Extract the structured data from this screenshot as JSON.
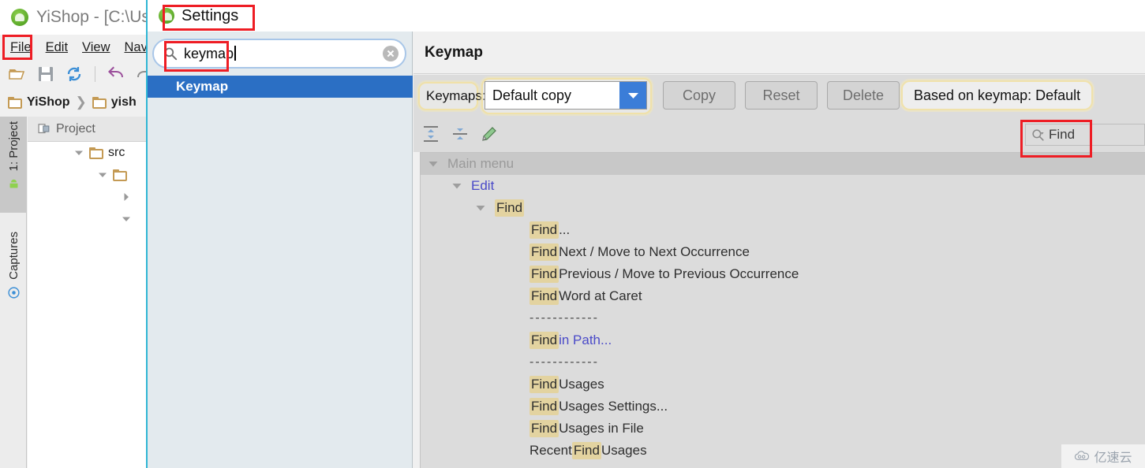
{
  "ide": {
    "title": "YiShop - [C:\\User",
    "app_icon": "android-studio-icon",
    "menus": [
      {
        "label": "File",
        "mnemonic": "F"
      },
      {
        "label": "Edit",
        "mnemonic": "E"
      },
      {
        "label": "View",
        "mnemonic": "V"
      },
      {
        "label": "Nav",
        "mnemonic": "N"
      }
    ],
    "toolbar_icons": [
      "open-folder-icon",
      "save-icon",
      "sync-icon",
      "undo-icon",
      "redo-icon"
    ],
    "breadcrumb": [
      {
        "label": "YiShop",
        "icon": "folder-icon"
      },
      {
        "label": "yish",
        "icon": "folder-icon"
      }
    ],
    "sidebar_tabs": [
      {
        "label": "1: Project",
        "icon": "android-icon",
        "active": true
      },
      {
        "label": "Captures",
        "icon": "captures-icon",
        "active": false
      }
    ],
    "project_tab": {
      "label": "Project",
      "icon": "project-view-icon"
    },
    "tree": [
      {
        "label": "src",
        "icon": "folder-icon",
        "expanded": true,
        "indent": 1
      },
      {
        "label": "",
        "icon": "folder-icon",
        "expanded": true,
        "indent": 2
      },
      {
        "label": "",
        "icon": "",
        "expanded": false,
        "indent": 3
      },
      {
        "label": "",
        "icon": "",
        "expanded": true,
        "indent": 3
      }
    ]
  },
  "dialog": {
    "title": "Settings",
    "icon": "android-studio-icon",
    "search": {
      "value": "keymap",
      "placeholder": "",
      "icon": "search-icon",
      "clear_icon": "clear-circle-icon"
    },
    "results": [
      {
        "label": "Keymap",
        "selected": true
      }
    ],
    "pane": {
      "title": "Keymap",
      "keymaps_label": "Keymaps:",
      "keymaps_value": "Default copy",
      "dropdown_icon": "chevron-down-icon",
      "buttons": [
        {
          "label": "Copy",
          "name": "copy-button"
        },
        {
          "label": "Reset",
          "name": "reset-button"
        },
        {
          "label": "Delete",
          "name": "delete-button"
        }
      ],
      "based_on": "Based on keymap: Default",
      "tool_icons": [
        "expand-all-icon",
        "collapse-all-icon",
        "edit-shortcut-icon"
      ],
      "find_label": "Find",
      "find_icon": "search-dropdown-icon"
    },
    "tree": [
      {
        "type": "node",
        "indent": 0,
        "arrow": "down",
        "label": "Main menu",
        "style": "header"
      },
      {
        "type": "node",
        "indent": 1,
        "arrow": "down",
        "label": "Edit",
        "style": "link"
      },
      {
        "type": "node",
        "indent": 2,
        "arrow": "down",
        "label": "Find",
        "style": "highlight-all"
      },
      {
        "type": "leaf",
        "indent": 3,
        "highlight": "Find",
        "rest": "..."
      },
      {
        "type": "leaf",
        "indent": 3,
        "highlight": "Find",
        "rest": " Next / Move to Next Occurrence"
      },
      {
        "type": "leaf",
        "indent": 3,
        "highlight": "Find",
        "rest": " Previous / Move to Previous Occurrence"
      },
      {
        "type": "leaf",
        "indent": 3,
        "highlight": "Find",
        "rest": " Word at Caret"
      },
      {
        "type": "separator",
        "indent": 3,
        "label": "------------"
      },
      {
        "type": "leaf",
        "indent": 3,
        "highlight": "Find",
        "rest": " in Path...",
        "style": "link"
      },
      {
        "type": "separator",
        "indent": 3,
        "label": "------------"
      },
      {
        "type": "leaf",
        "indent": 3,
        "highlight": "Find",
        "rest": " Usages"
      },
      {
        "type": "leaf",
        "indent": 3,
        "highlight": "Find",
        "rest": " Usages Settings..."
      },
      {
        "type": "leaf",
        "indent": 3,
        "highlight": "Find",
        "rest": " Usages in File"
      },
      {
        "type": "leaf",
        "indent": 3,
        "prefix": "Recent ",
        "highlight": "Find",
        "rest": " Usages"
      }
    ]
  },
  "watermark": {
    "text": "亿速云",
    "icon": "cloud-icon"
  },
  "colors": {
    "annotation": "#ee1d24",
    "selection": "#2b6fc4",
    "highlight": "#e3d3a0",
    "dialog_border": "#2fb6d4",
    "link": "#4a4ac8",
    "dropdown_arrow_bg": "#3b7dd8"
  }
}
